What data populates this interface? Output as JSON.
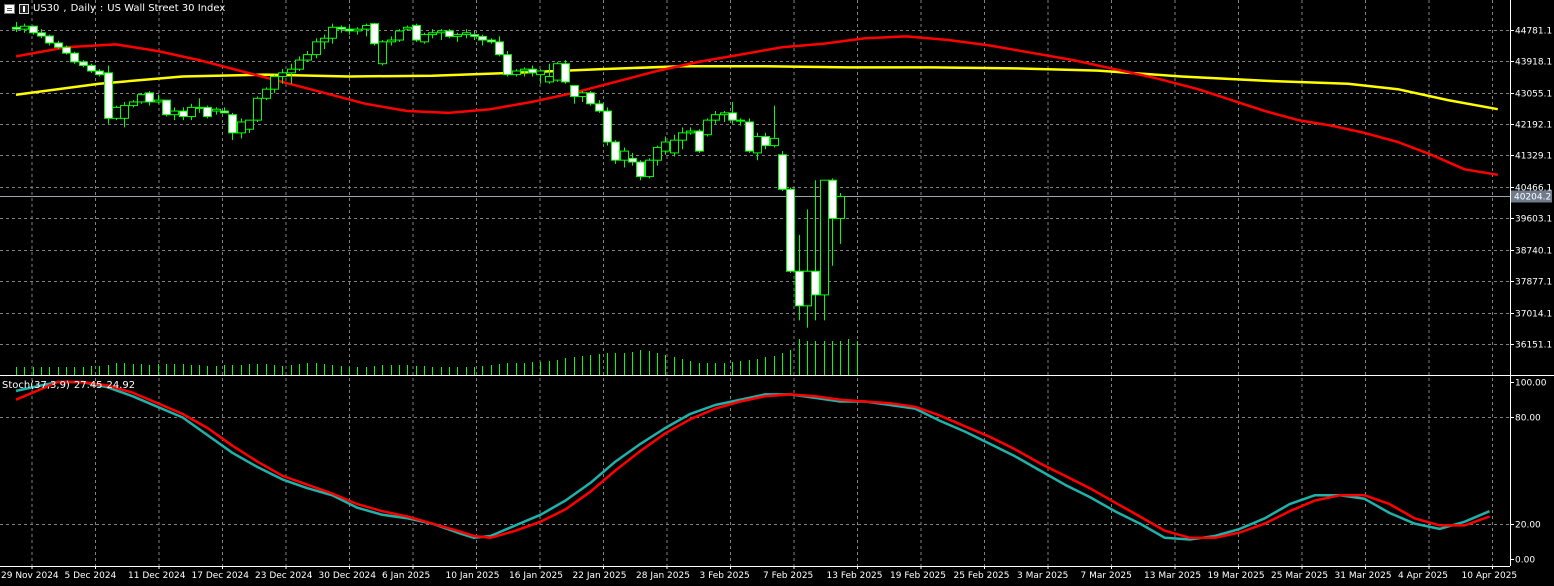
{
  "header": {
    "symbol": "US30",
    "timeframe": "Daily",
    "description": "US Wall Street 30 Index",
    "icons": [
      "menu-icon",
      "candle-chart-icon"
    ]
  },
  "stoch_header": {
    "name": "Stoch(37,3,9)",
    "main_value": "27.45",
    "signal_value": "24.92"
  },
  "colors": {
    "background": "#000000",
    "grid": "#808080",
    "bull_candle": "#00ff00",
    "bear_candle": "#ffffff",
    "ma_fast": "#ff0000",
    "ma_slow": "#ffff00",
    "stoch_main": "#20b2aa",
    "stoch_signal": "#ff0000",
    "volume": "#00ff00",
    "current_price_tag_bg": "#707b8c"
  },
  "chart_data": {
    "type": "candlestick",
    "symbol": "US30",
    "timeframe": "Daily",
    "price_ylim": [
      35300,
      45600
    ],
    "price_axis_ticks": [
      "44781.1",
      "43918.1",
      "43055.1",
      "42192.1",
      "41329.1",
      "40466.1",
      "39603.1",
      "38740.1",
      "37877.1",
      "37014.1",
      "36151.1"
    ],
    "current_price_label": "40204.2",
    "current_price": 40204.2,
    "x_axis_labels": [
      "29 Nov 2024",
      "5 Dec 2024",
      "11 Dec 2024",
      "17 Dec 2024",
      "23 Dec 2024",
      "30 Dec 2024",
      "6 Jan 2025",
      "10 Jan 2025",
      "16 Jan 2025",
      "22 Jan 2025",
      "28 Jan 2025",
      "3 Feb 2025",
      "7 Feb 2025",
      "13 Feb 2025",
      "19 Feb 2025",
      "25 Feb 2025",
      "3 Mar 2025",
      "7 Mar 2025",
      "13 Mar 2025",
      "19 Mar 2025",
      "25 Mar 2025",
      "31 Mar 2025",
      "4 Apr 2025",
      "10 Apr 2025"
    ],
    "ohlc": [
      [
        44850,
        45000,
        44720,
        44800
      ],
      [
        44800,
        44950,
        44700,
        44880
      ],
      [
        44880,
        44900,
        44650,
        44700
      ],
      [
        44700,
        44800,
        44550,
        44610
      ],
      [
        44610,
        44650,
        44350,
        44420
      ],
      [
        44420,
        44480,
        44250,
        44300
      ],
      [
        44300,
        44350,
        44100,
        44140
      ],
      [
        44140,
        44180,
        43850,
        43900
      ],
      [
        43900,
        43950,
        43750,
        43800
      ],
      [
        43800,
        43850,
        43600,
        43650
      ],
      [
        43650,
        43700,
        43500,
        43550
      ],
      [
        43600,
        43800,
        42200,
        42350
      ],
      [
        42350,
        42700,
        42300,
        42650
      ],
      [
        42350,
        42800,
        42100,
        42700
      ],
      [
        42700,
        42850,
        42650,
        42800
      ],
      [
        42800,
        43050,
        42750,
        43000
      ],
      [
        43050,
        43100,
        42700,
        42800
      ],
      [
        42800,
        43000,
        42750,
        42850
      ],
      [
        42850,
        42850,
        42400,
        42450
      ],
      [
        42450,
        42650,
        42300,
        42550
      ],
      [
        42550,
        42650,
        42300,
        42400
      ],
      [
        42400,
        42750,
        42300,
        42650
      ],
      [
        42650,
        42900,
        42500,
        42650
      ],
      [
        42650,
        42700,
        42350,
        42400
      ],
      [
        42550,
        42650,
        42450,
        42600
      ],
      [
        42550,
        42650,
        42500,
        42500
      ],
      [
        42450,
        42500,
        41750,
        41950
      ],
      [
        41950,
        42350,
        41800,
        42250
      ],
      [
        42050,
        42300,
        41950,
        42300
      ],
      [
        42300,
        42950,
        42250,
        42900
      ],
      [
        42900,
        43200,
        42850,
        43150
      ],
      [
        43150,
        43550,
        43050,
        43500
      ],
      [
        43500,
        43700,
        43300,
        43600
      ],
      [
        43600,
        43850,
        43300,
        43700
      ],
      [
        43700,
        44050,
        43650,
        43950
      ],
      [
        43950,
        44200,
        43900,
        44100
      ],
      [
        44100,
        44550,
        44000,
        44450
      ],
      [
        44450,
        44650,
        44250,
        44550
      ],
      [
        44550,
        44950,
        44400,
        44850
      ],
      [
        44850,
        44900,
        44700,
        44800
      ],
      [
        44800,
        44900,
        44650,
        44750
      ],
      [
        44750,
        44850,
        44650,
        44800
      ],
      [
        44800,
        44950,
        44600,
        44900
      ],
      [
        44950,
        44970,
        44350,
        44400
      ],
      [
        43850,
        44500,
        43800,
        44450
      ],
      [
        44450,
        44600,
        44350,
        44500
      ],
      [
        44500,
        44800,
        44450,
        44750
      ],
      [
        44800,
        44900,
        44750,
        44850
      ],
      [
        44900,
        44950,
        44450,
        44500
      ],
      [
        44450,
        44700,
        44400,
        44650
      ],
      [
        44650,
        44800,
        44550,
        44700
      ],
      [
        44700,
        44800,
        44500,
        44750
      ],
      [
        44750,
        44800,
        44550,
        44600
      ],
      [
        44600,
        44700,
        44450,
        44650
      ],
      [
        44650,
        44800,
        44550,
        44700
      ],
      [
        44650,
        44750,
        44500,
        44600
      ],
      [
        44600,
        44650,
        44350,
        44500
      ],
      [
        44500,
        44550,
        44400,
        44450
      ],
      [
        44450,
        44600,
        44050,
        44100
      ],
      [
        44100,
        44200,
        43500,
        43550
      ],
      [
        43550,
        43700,
        43500,
        43650
      ],
      [
        43650,
        43750,
        43500,
        43700
      ],
      [
        43700,
        43800,
        43500,
        43600
      ],
      [
        43550,
        43700,
        43300,
        43650
      ],
      [
        43350,
        43850,
        43300,
        43500
      ],
      [
        43400,
        43900,
        43350,
        43850
      ],
      [
        43850,
        43950,
        43300,
        43350
      ],
      [
        43250,
        43250,
        42750,
        42950
      ],
      [
        42950,
        43100,
        42800,
        43050
      ],
      [
        43050,
        43100,
        42700,
        42750
      ],
      [
        42750,
        42850,
        42500,
        42550
      ],
      [
        42550,
        42650,
        41600,
        41700
      ],
      [
        41700,
        41750,
        41100,
        41200
      ],
      [
        41200,
        41550,
        41000,
        41450
      ],
      [
        41250,
        41400,
        41050,
        41150
      ],
      [
        41150,
        41200,
        40650,
        40750
      ],
      [
        40750,
        41250,
        40700,
        41200
      ],
      [
        41200,
        41600,
        41050,
        41550
      ],
      [
        41450,
        41850,
        41350,
        41700
      ],
      [
        41400,
        41900,
        41300,
        41750
      ],
      [
        41750,
        42100,
        41500,
        41950
      ],
      [
        41950,
        42100,
        41900,
        42000
      ],
      [
        42000,
        42050,
        41400,
        41450
      ],
      [
        41900,
        42350,
        41850,
        42300
      ],
      [
        42300,
        42550,
        42200,
        42450
      ],
      [
        42450,
        42550,
        42250,
        42500
      ],
      [
        42500,
        42800,
        42200,
        42300
      ],
      [
        42300,
        42350,
        42150,
        42300
      ],
      [
        42250,
        42350,
        41400,
        41450
      ],
      [
        41400,
        41950,
        41200,
        41850
      ],
      [
        41850,
        41950,
        41500,
        41600
      ],
      [
        41600,
        42700,
        41550,
        41800
      ],
      [
        41350,
        41450,
        40350,
        40400
      ],
      [
        40400,
        40450,
        38100,
        38150
      ],
      [
        38150,
        39150,
        36800,
        37200
      ],
      [
        37200,
        39850,
        36600,
        38150
      ],
      [
        38150,
        40650,
        36800,
        37500
      ],
      [
        37500,
        40650,
        36800,
        40650
      ],
      [
        40650,
        40700,
        38300,
        39600
      ],
      [
        39600,
        40300,
        38900,
        40204
      ]
    ],
    "volume": [
      8,
      8,
      8,
      8,
      8,
      8,
      8,
      8,
      8,
      9,
      9,
      10,
      12,
      12,
      11,
      11,
      10,
      11,
      11,
      11,
      11,
      10,
      10,
      9,
      9,
      10,
      10,
      10,
      11,
      11,
      11,
      10,
      9,
      10,
      11,
      12,
      12,
      11,
      10,
      9,
      8,
      8,
      8,
      9,
      10,
      10,
      10,
      10,
      9,
      9,
      8,
      8,
      8,
      8,
      8,
      8,
      9,
      10,
      11,
      12,
      12,
      12,
      13,
      13,
      14,
      15,
      17,
      18,
      19,
      20,
      21,
      22,
      22,
      22,
      23,
      25,
      24,
      22,
      20,
      18,
      16,
      14,
      12,
      12,
      12,
      12,
      13,
      14,
      15,
      16,
      18,
      19,
      22,
      25,
      36,
      34,
      34,
      34,
      34,
      34,
      36,
      34
    ],
    "ma_fast": {
      "color": "#ff0000",
      "points": [
        [
          0,
          44050
        ],
        [
          6,
          44300
        ],
        [
          12,
          44380
        ],
        [
          17,
          44200
        ],
        [
          22,
          43950
        ],
        [
          27,
          43650
        ],
        [
          32,
          43350
        ],
        [
          37,
          43050
        ],
        [
          42,
          42750
        ],
        [
          47,
          42550
        ],
        [
          52,
          42500
        ],
        [
          57,
          42600
        ],
        [
          62,
          42800
        ],
        [
          67,
          43050
        ],
        [
          72,
          43350
        ],
        [
          77,
          43650
        ],
        [
          82,
          43900
        ],
        [
          87,
          44100
        ],
        [
          92,
          44300
        ],
        [
          97,
          44400
        ],
        [
          102,
          44550
        ],
        [
          107,
          44600
        ],
        [
          112,
          44500
        ],
        [
          117,
          44350
        ],
        [
          122,
          44150
        ],
        [
          127,
          43950
        ],
        [
          132,
          43700
        ],
        [
          137,
          43450
        ],
        [
          142,
          43150
        ],
        [
          146,
          42850
        ],
        [
          150,
          42550
        ],
        [
          154,
          42300
        ],
        [
          158,
          42150
        ],
        [
          162,
          41950
        ],
        [
          166,
          41700
        ],
        [
          170,
          41350
        ],
        [
          174,
          40950
        ],
        [
          178,
          40800
        ]
      ]
    },
    "ma_slow": {
      "color": "#ffff00",
      "points": [
        [
          0,
          43000
        ],
        [
          10,
          43300
        ],
        [
          20,
          43500
        ],
        [
          30,
          43550
        ],
        [
          40,
          43500
        ],
        [
          50,
          43520
        ],
        [
          60,
          43600
        ],
        [
          70,
          43700
        ],
        [
          80,
          43780
        ],
        [
          90,
          43780
        ],
        [
          100,
          43750
        ],
        [
          110,
          43750
        ],
        [
          120,
          43720
        ],
        [
          130,
          43660
        ],
        [
          140,
          43500
        ],
        [
          150,
          43380
        ],
        [
          160,
          43300
        ],
        [
          166,
          43150
        ],
        [
          172,
          42850
        ],
        [
          178,
          42600
        ]
      ]
    },
    "stochastic": {
      "title": "Stoch(37,3,9)",
      "main_value": 27.45,
      "signal_value": 24.92,
      "ylim": [
        0,
        100
      ],
      "axis_ticks": [
        "100.00",
        "80.00",
        "20.00",
        "0.00"
      ],
      "main_color": "#20b2aa",
      "signal_color": "#ff0000",
      "main": [
        [
          0,
          95
        ],
        [
          3,
          98
        ],
        [
          5,
          100
        ],
        [
          8,
          100
        ],
        [
          11,
          97
        ],
        [
          14,
          92
        ],
        [
          17,
          86
        ],
        [
          20,
          80
        ],
        [
          23,
          70
        ],
        [
          26,
          60
        ],
        [
          29,
          52
        ],
        [
          32,
          45
        ],
        [
          35,
          40
        ],
        [
          38,
          36
        ],
        [
          41,
          29
        ],
        [
          44,
          25
        ],
        [
          47,
          23
        ],
        [
          50,
          20
        ],
        [
          53,
          15
        ],
        [
          55,
          12
        ],
        [
          57,
          13
        ],
        [
          60,
          19
        ],
        [
          63,
          25
        ],
        [
          66,
          33
        ],
        [
          69,
          43
        ],
        [
          72,
          55
        ],
        [
          75,
          65
        ],
        [
          78,
          74
        ],
        [
          81,
          82
        ],
        [
          84,
          87
        ],
        [
          87,
          90
        ],
        [
          90,
          93
        ],
        [
          93,
          93
        ],
        [
          96,
          91
        ],
        [
          99,
          89
        ],
        [
          102,
          89
        ],
        [
          105,
          87
        ],
        [
          108,
          85
        ],
        [
          111,
          78
        ],
        [
          114,
          72
        ],
        [
          117,
          65
        ],
        [
          120,
          58
        ],
        [
          123,
          50
        ],
        [
          126,
          42
        ],
        [
          129,
          35
        ],
        [
          132,
          27
        ],
        [
          135,
          20
        ],
        [
          138,
          12
        ],
        [
          141,
          11
        ],
        [
          144,
          13
        ],
        [
          147,
          17
        ],
        [
          150,
          23
        ],
        [
          153,
          31
        ],
        [
          156,
          36
        ],
        [
          159,
          36
        ],
        [
          162,
          34
        ],
        [
          165,
          26
        ],
        [
          168,
          20
        ],
        [
          171,
          17
        ],
        [
          174,
          21
        ],
        [
          177,
          27
        ]
      ],
      "signal": [
        [
          0,
          90
        ],
        [
          3,
          96
        ],
        [
          5,
          100
        ],
        [
          8,
          100
        ],
        [
          11,
          98
        ],
        [
          14,
          94
        ],
        [
          17,
          88
        ],
        [
          20,
          82
        ],
        [
          23,
          74
        ],
        [
          26,
          64
        ],
        [
          29,
          55
        ],
        [
          32,
          47
        ],
        [
          35,
          42
        ],
        [
          38,
          37
        ],
        [
          41,
          31
        ],
        [
          44,
          27
        ],
        [
          47,
          24
        ],
        [
          50,
          20
        ],
        [
          53,
          16
        ],
        [
          55,
          13
        ],
        [
          57,
          12
        ],
        [
          60,
          16
        ],
        [
          63,
          21
        ],
        [
          66,
          28
        ],
        [
          69,
          38
        ],
        [
          72,
          50
        ],
        [
          75,
          61
        ],
        [
          78,
          71
        ],
        [
          81,
          79
        ],
        [
          84,
          85
        ],
        [
          87,
          89
        ],
        [
          90,
          92
        ],
        [
          93,
          93
        ],
        [
          96,
          92
        ],
        [
          99,
          90
        ],
        [
          102,
          89
        ],
        [
          105,
          88
        ],
        [
          108,
          86
        ],
        [
          111,
          81
        ],
        [
          114,
          75
        ],
        [
          117,
          69
        ],
        [
          120,
          62
        ],
        [
          123,
          54
        ],
        [
          126,
          47
        ],
        [
          129,
          40
        ],
        [
          132,
          32
        ],
        [
          135,
          24
        ],
        [
          138,
          16
        ],
        [
          141,
          12
        ],
        [
          144,
          12
        ],
        [
          147,
          15
        ],
        [
          150,
          20
        ],
        [
          153,
          27
        ],
        [
          156,
          33
        ],
        [
          159,
          36
        ],
        [
          162,
          36
        ],
        [
          165,
          31
        ],
        [
          168,
          23
        ],
        [
          171,
          19
        ],
        [
          174,
          19
        ],
        [
          177,
          24
        ]
      ]
    }
  }
}
